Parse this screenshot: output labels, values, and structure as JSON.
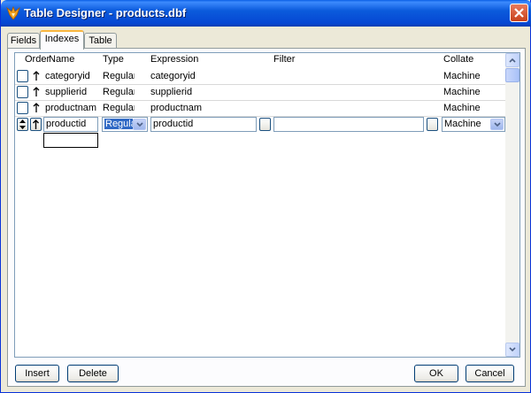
{
  "window": {
    "title": "Table Designer - products.dbf"
  },
  "tabs": [
    {
      "label": "Fields",
      "active": false
    },
    {
      "label": "Indexes",
      "active": true
    },
    {
      "label": "Table",
      "active": false
    }
  ],
  "columns": {
    "order": "Order",
    "name": "Name",
    "type": "Type",
    "expression": "Expression",
    "filter": "Filter",
    "collate": "Collate"
  },
  "rows": [
    {
      "name": "categoryid",
      "type": "Regular",
      "expression": "categoryid",
      "filter": "",
      "collate": "Machine"
    },
    {
      "name": "supplierid",
      "type": "Regular",
      "expression": "supplierid",
      "filter": "",
      "collate": "Machine"
    },
    {
      "name": "productnam",
      "type": "Regular",
      "expression": "productnam",
      "filter": "",
      "collate": "Machine"
    }
  ],
  "edit_row": {
    "name": "productid",
    "type": "Regular",
    "expression": "productid",
    "filter": "",
    "collate": "Machine",
    "new_name": ""
  },
  "buttons": {
    "insert": "Insert",
    "delete": "Delete",
    "ok": "OK",
    "cancel": "Cancel"
  },
  "colors": {
    "title_bar": "#0b5bdc",
    "selection": "#316ac5",
    "active_tab_accent": "#f9b63f"
  }
}
